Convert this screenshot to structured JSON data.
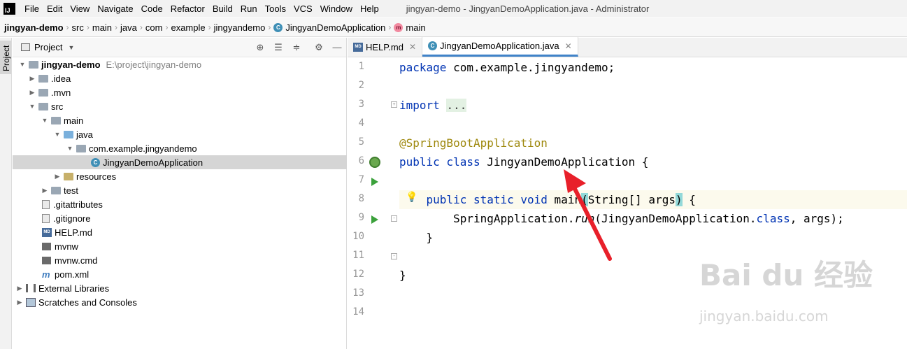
{
  "menubar": {
    "logo": "IJ",
    "items": [
      "File",
      "Edit",
      "View",
      "Navigate",
      "Code",
      "Refactor",
      "Build",
      "Run",
      "Tools",
      "VCS",
      "Window",
      "Help"
    ],
    "title": "jingyan-demo - JingyanDemoApplication.java - Administrator"
  },
  "breadcrumb": {
    "items": [
      "jingyan-demo",
      "src",
      "main",
      "java",
      "com",
      "example",
      "jingyandemo",
      "JingyanDemoApplication",
      "main"
    ]
  },
  "sidebar": {
    "project_tab": "Project"
  },
  "project_panel": {
    "title": "Project",
    "tree": [
      {
        "label": "jingyan-demo",
        "path": "E:\\project\\jingyan-demo",
        "icon": "folder-icon"
      },
      {
        "label": ".idea",
        "icon": "folder-icon"
      },
      {
        "label": ".mvn",
        "icon": "folder-icon"
      },
      {
        "label": "src",
        "icon": "folder-icon"
      },
      {
        "label": "main",
        "icon": "folder-icon"
      },
      {
        "label": "java",
        "icon": "source-folder-icon"
      },
      {
        "label": "com.example.jingyandemo",
        "icon": "package-icon"
      },
      {
        "label": "JingyanDemoApplication",
        "icon": "class-icon"
      },
      {
        "label": "resources",
        "icon": "resources-folder-icon"
      },
      {
        "label": "test",
        "icon": "folder-icon"
      },
      {
        "label": ".gitattributes",
        "icon": "file-icon"
      },
      {
        "label": ".gitignore",
        "icon": "file-icon"
      },
      {
        "label": "HELP.md",
        "icon": "markdown-icon"
      },
      {
        "label": "mvnw",
        "icon": "script-icon"
      },
      {
        "label": "mvnw.cmd",
        "icon": "script-icon"
      },
      {
        "label": "pom.xml",
        "icon": "maven-icon"
      },
      {
        "label": "External Libraries",
        "icon": "library-icon"
      },
      {
        "label": "Scratches and Consoles",
        "icon": "scratches-icon"
      }
    ]
  },
  "editor": {
    "tabs": [
      {
        "label": "HELP.md",
        "icon": "markdown-icon"
      },
      {
        "label": "JingyanDemoApplication.java",
        "icon": "class-icon"
      }
    ],
    "line_numbers": [
      "1",
      "2",
      "3",
      "4",
      "5",
      "6",
      "7",
      "8",
      "9",
      "10",
      "11",
      "12",
      "13",
      "14"
    ],
    "code": {
      "l1_kw": "package",
      "l1_rest": " com.example.jingyandemo;",
      "l3_kw": "import",
      "l3_fold": "...",
      "l6_ann": "@SpringBootApplication",
      "l7_kw": "public class",
      "l7_rest": " JingyanDemoApplication {",
      "l9_kw": "public static void",
      "l9_name": " main",
      "l9_open": "(",
      "l9_args": "String[] args",
      "l9_close": ")",
      "l9_end": " {",
      "l10_a": "SpringApplication.",
      "l10_run": "run",
      "l10_b": "(JingyanDemoApplication.",
      "l10_class": "class",
      "l10_c": ", args);",
      "l11": "}",
      "l13": "}"
    }
  },
  "watermark": {
    "brand": "Bai du 经验",
    "url": "jingyan.baidu.com"
  },
  "colors": {
    "accent": "#4083c9",
    "arrow": "#e8202a",
    "keyword": "#0033b3",
    "annotation": "#9e880d"
  }
}
